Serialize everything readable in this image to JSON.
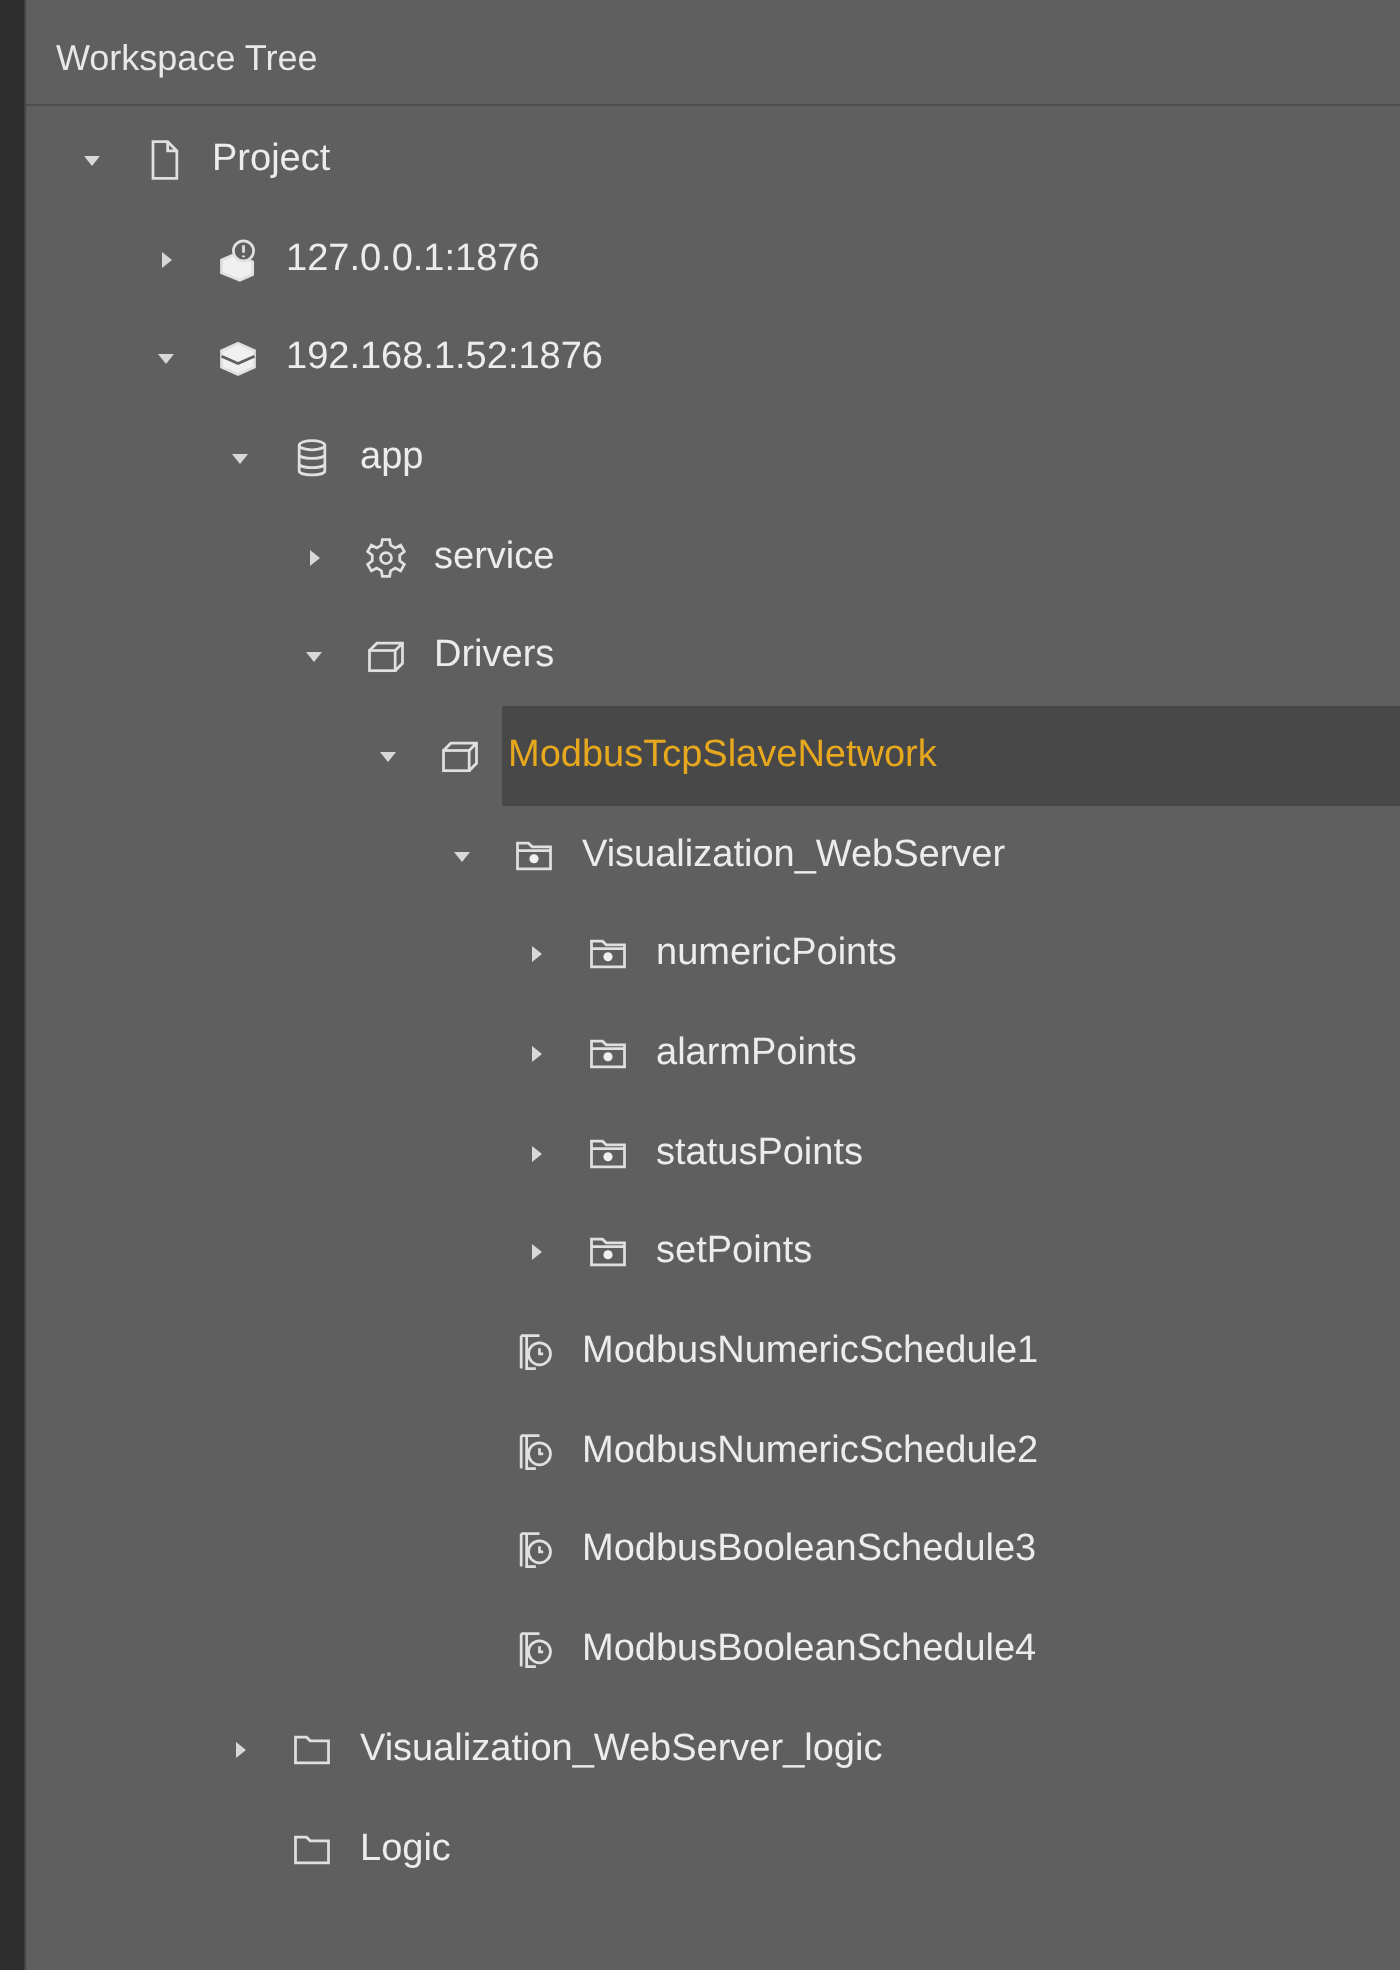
{
  "panel": {
    "title": "Workspace Tree"
  },
  "tree": [
    {
      "label": "Project",
      "kind": "document",
      "expanded": true,
      "selected": false,
      "children": [
        {
          "label": "127.0.0.1:1876",
          "kind": "server-alert",
          "expanded": false,
          "selected": false
        },
        {
          "label": "192.168.1.52:1876",
          "kind": "server",
          "expanded": true,
          "selected": false,
          "children": [
            {
              "label": "app",
              "kind": "database",
              "expanded": true,
              "selected": false,
              "children": [
                {
                  "label": "service",
                  "kind": "gear",
                  "expanded": false,
                  "selected": false
                },
                {
                  "label": "Drivers",
                  "kind": "stack",
                  "expanded": true,
                  "selected": false,
                  "children": [
                    {
                      "label": "ModbusTcpSlaveNetwork",
                      "kind": "stack",
                      "expanded": true,
                      "selected": true,
                      "children": [
                        {
                          "label": "Visualization_WebServer",
                          "kind": "folder-dot",
                          "expanded": true,
                          "selected": false,
                          "children": [
                            {
                              "label": "numericPoints",
                              "kind": "folder-dot",
                              "expanded": false,
                              "selected": false
                            },
                            {
                              "label": "alarmPoints",
                              "kind": "folder-dot",
                              "expanded": false,
                              "selected": false
                            },
                            {
                              "label": "statusPoints",
                              "kind": "folder-dot",
                              "expanded": false,
                              "selected": false
                            },
                            {
                              "label": "setPoints",
                              "kind": "folder-dot",
                              "expanded": false,
                              "selected": false
                            }
                          ]
                        },
                        {
                          "label": "ModbusNumericSchedule1",
                          "kind": "schedule",
                          "selected": false
                        },
                        {
                          "label": "ModbusNumericSchedule2",
                          "kind": "schedule",
                          "selected": false
                        },
                        {
                          "label": "ModbusBooleanSchedule3",
                          "kind": "schedule",
                          "selected": false
                        },
                        {
                          "label": "ModbusBooleanSchedule4",
                          "kind": "schedule",
                          "selected": false
                        }
                      ]
                    }
                  ]
                }
              ]
            },
            {
              "label": "Visualization_WebServer_logic",
              "kind": "folder",
              "expanded": false,
              "selected": false
            },
            {
              "label": "Logic",
              "kind": "folder",
              "selected": false
            }
          ]
        }
      ]
    }
  ]
}
